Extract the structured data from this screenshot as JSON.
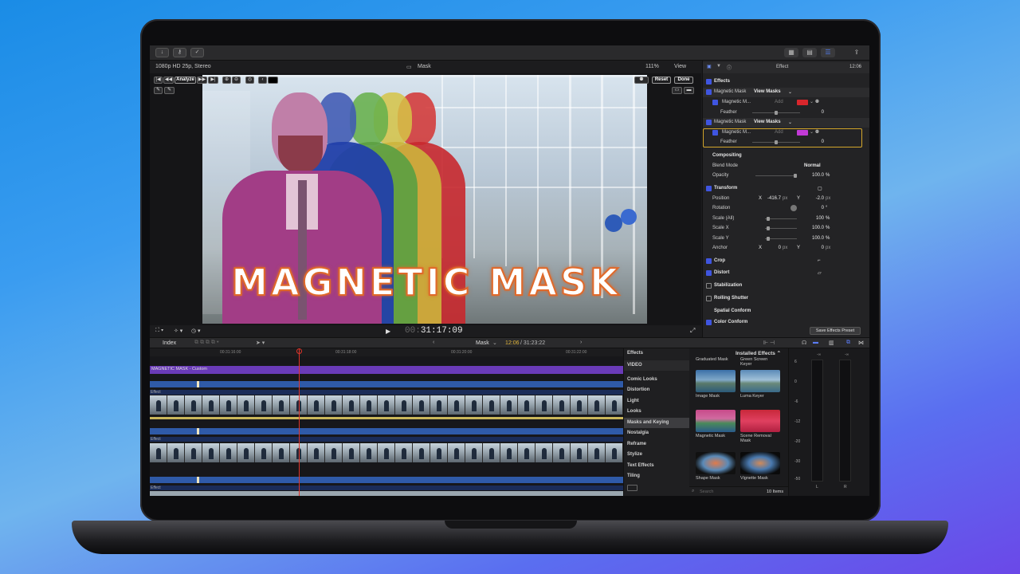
{
  "toolbar": {
    "left_icons": [
      "download-icon",
      "key-icon",
      "checkmark-icon"
    ],
    "right_icons": [
      "grid-icon",
      "list-icon",
      "inspector-icon",
      "share-icon"
    ]
  },
  "viewer": {
    "format": "1080p HD 25p, Stereo",
    "clip_name": "Mask",
    "zoom": "111%",
    "view_label": "View",
    "analyze_label": "Analyze",
    "reset_label": "Reset",
    "done_label": "Done",
    "title_overlay": "MAGNETIC MASK",
    "timecode_dim": "00:",
    "timecode": "31:17:09"
  },
  "inspector": {
    "header_title": "Effect",
    "header_time": "12:06",
    "effects_label": "Effects",
    "mask1_name": "Magnetic Mask",
    "view_masks": "View Masks",
    "sub_mask_name": "Magnetic M...",
    "add_label": "Add",
    "feather_label": "Feather",
    "feather_value": "0",
    "mask2_name": "Magnetic Mask",
    "compositing": "Compositing",
    "blend_mode_label": "Blend Mode",
    "blend_mode_value": "Normal",
    "opacity_label": "Opacity",
    "opacity_value": "100.0",
    "percent": "%",
    "transform": "Transform",
    "position_label": "Position",
    "x_label": "X",
    "y_label": "Y",
    "position_x": "-416.7",
    "position_y": "-2.0",
    "px": "px",
    "rotation_label": "Rotation",
    "rotation_value": "0",
    "degree": "°",
    "scale_all_label": "Scale (All)",
    "scale_all_value": "100",
    "scale_x_label": "Scale X",
    "scale_x_value": "100.0",
    "scale_y_label": "Scale Y",
    "scale_y_value": "100.0",
    "anchor_label": "Anchor",
    "anchor_x": "0",
    "anchor_y": "0",
    "crop": "Crop",
    "distort": "Distort",
    "stabilization": "Stabilization",
    "rolling_shutter": "Rolling Shutter",
    "spatial_conform": "Spatial Conform",
    "color_conform": "Color Conform",
    "save_preset": "Save Effects Preset",
    "mask1_color": "#d8262c",
    "mask2_color": "#c23ad6"
  },
  "timeline": {
    "index_label": "Index",
    "project_name": "Mask",
    "position": "12:06",
    "duration": "31:23:22",
    "ruler": [
      "00:31:16:00",
      "00:31:18:00",
      "00:31:20:00",
      "00:31:22:00"
    ],
    "title_clip": "MAGNETIC MASK - Custom",
    "effect_label": "Effect"
  },
  "effects_browser": {
    "header": "Effects",
    "installed": "Installed Effects",
    "categories": [
      "VIDEO",
      "Comic Looks",
      "Distortion",
      "Light",
      "Looks",
      "Masks and Keying",
      "Nostalgia",
      "Reframe",
      "Stylize",
      "Text Effects",
      "Tiling"
    ],
    "selected": "Masks and Keying",
    "items": [
      "Graduated Mask",
      "Green Screen Keyer",
      "Image Mask",
      "Luma Keyer",
      "Magnetic Mask",
      "Scene Removal Mask",
      "Shape Mask",
      "Vignette Mask"
    ],
    "search_placeholder": "Search",
    "count": "10 Items"
  },
  "meters": {
    "scale": [
      "6",
      "0",
      "-6",
      "-12",
      "-20",
      "-30",
      "-50"
    ],
    "peak": "-∞",
    "left": "L",
    "right": "R"
  }
}
